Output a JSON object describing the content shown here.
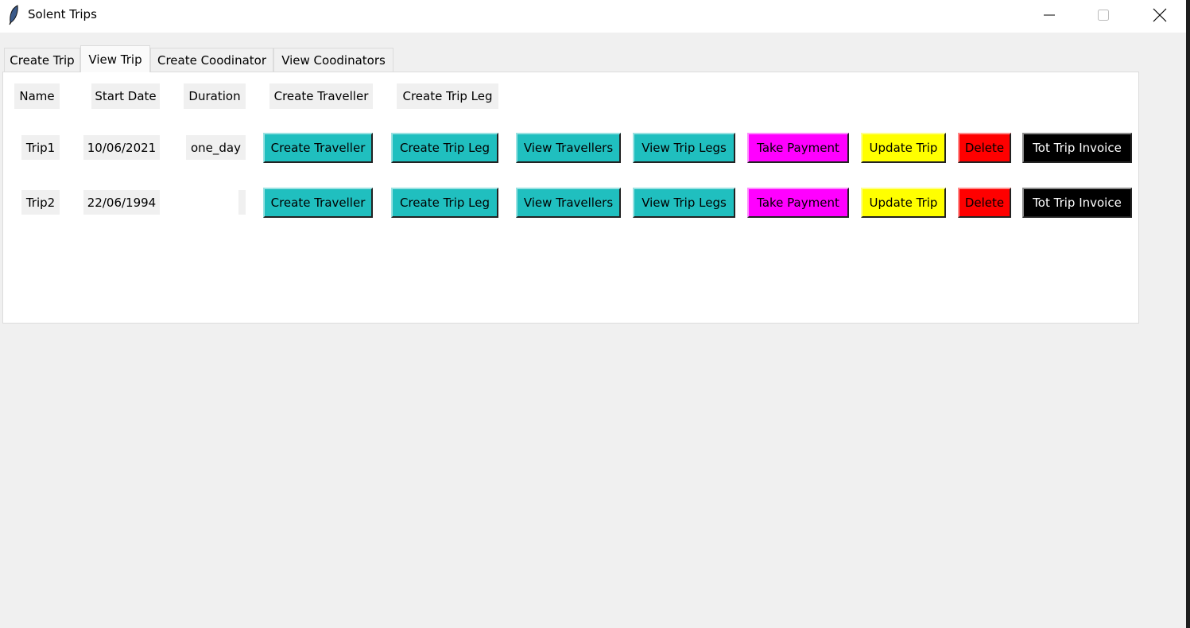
{
  "window": {
    "title": "Solent Trips"
  },
  "tabs": [
    {
      "label": "Create Trip",
      "active": false
    },
    {
      "label": "View Trip",
      "active": true
    },
    {
      "label": "Create Coodinator",
      "active": false
    },
    {
      "label": "View Coodinators",
      "active": false
    }
  ],
  "headers": {
    "name": "Name",
    "start_date": "Start Date",
    "duration": "Duration",
    "create_traveller": "Create Traveller",
    "create_trip_leg": "Create Trip Leg"
  },
  "rows": [
    {
      "name": "Trip1",
      "start_date": "10/06/2021",
      "duration": "one_day"
    },
    {
      "name": "Trip2",
      "start_date": "22/06/1994",
      "duration": ""
    }
  ],
  "actions": [
    {
      "label": "Create Traveller",
      "color": "#20bfbf",
      "text_color": "#000000"
    },
    {
      "label": "Create Trip Leg",
      "color": "#20bfbf",
      "text_color": "#000000"
    },
    {
      "label": "View Travellers",
      "color": "#20bfbf",
      "text_color": "#000000"
    },
    {
      "label": "View Trip Legs",
      "color": "#20bfbf",
      "text_color": "#000000"
    },
    {
      "label": "Take Payment",
      "color": "#ff00ff",
      "text_color": "#000000"
    },
    {
      "label": "Update Trip",
      "color": "#ffff00",
      "text_color": "#000000"
    },
    {
      "label": "Delete",
      "color": "#ff0000",
      "text_color": "#000000"
    },
    {
      "label": "Tot Trip Invoice",
      "color": "#000000",
      "text_color": "#ffffff"
    }
  ]
}
